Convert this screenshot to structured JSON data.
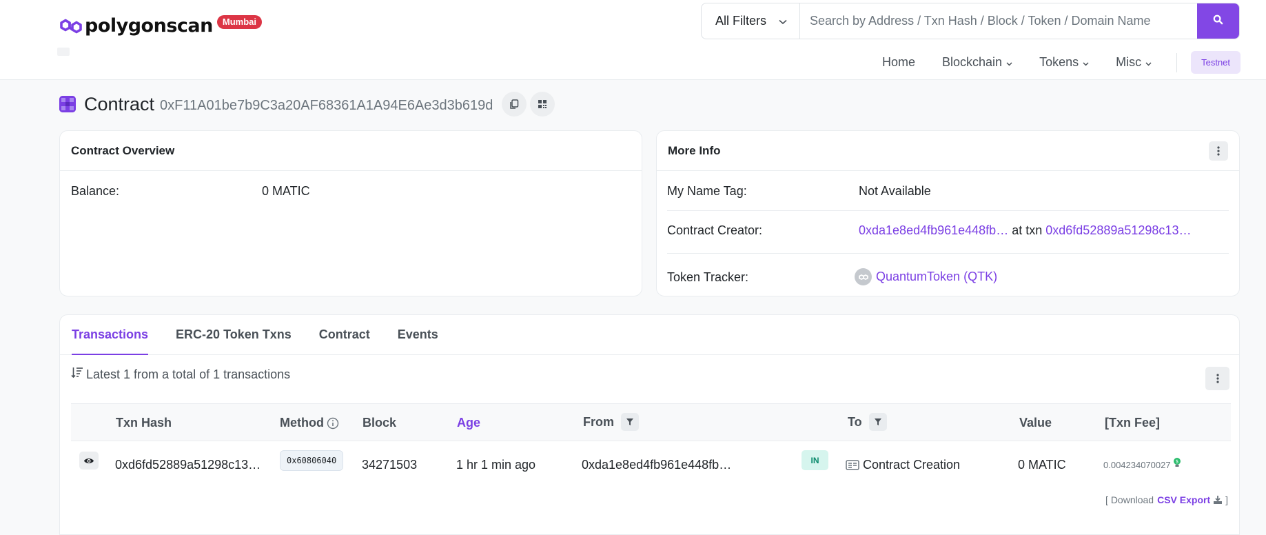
{
  "header": {
    "brand": "polygonscan",
    "network_badge": "Mumbai",
    "search": {
      "filter_label": "All Filters",
      "placeholder": "Search by Address / Txn Hash / Block / Token / Domain Name"
    },
    "nav": {
      "home": "Home",
      "blockchain": "Blockchain",
      "tokens": "Tokens",
      "misc": "Misc",
      "testnet": "Testnet"
    }
  },
  "page": {
    "title": "Contract",
    "address": "0xF11A01be7b9C3a20AF68361A1A94E6Ae3d3b619d"
  },
  "overview": {
    "heading": "Contract Overview",
    "balance_label": "Balance:",
    "balance_value": "0 MATIC"
  },
  "more_info": {
    "heading": "More Info",
    "name_tag_label": "My Name Tag:",
    "name_tag_value": "Not Available",
    "creator_label": "Contract Creator:",
    "creator_address": "0xda1e8ed4fb961e448fb…",
    "creator_at_txn": "at txn",
    "creator_txn": "0xd6fd52889a51298c13…",
    "token_tracker_label": "Token Tracker:",
    "token_tracker_value": "QuantumToken (QTK)"
  },
  "tabs": [
    "Transactions",
    "ERC-20 Token Txns",
    "Contract",
    "Events"
  ],
  "transactions": {
    "summary": "Latest 1 from a total of 1 transactions",
    "columns": {
      "txn_hash": "Txn Hash",
      "method": "Method",
      "block": "Block",
      "age": "Age",
      "from": "From",
      "to": "To",
      "value": "Value",
      "fee": "[Txn Fee]"
    },
    "rows": [
      {
        "txn_hash": "0xd6fd52889a51298c13…",
        "method": "0x60806040",
        "block": "34271503",
        "age": "1 hr 1 min ago",
        "from": "0xda1e8ed4fb961e448fb…",
        "direction": "IN",
        "to": "Contract Creation",
        "value": "0 MATIC",
        "fee": "0.004234070027"
      }
    ],
    "download_prefix": "[ Download",
    "csv_export": "CSV Export",
    "download_suffix": "]"
  },
  "colors": {
    "accent": "#7b3fe4",
    "badge_red": "#dc3545",
    "in_badge": "#d6f5ee"
  }
}
